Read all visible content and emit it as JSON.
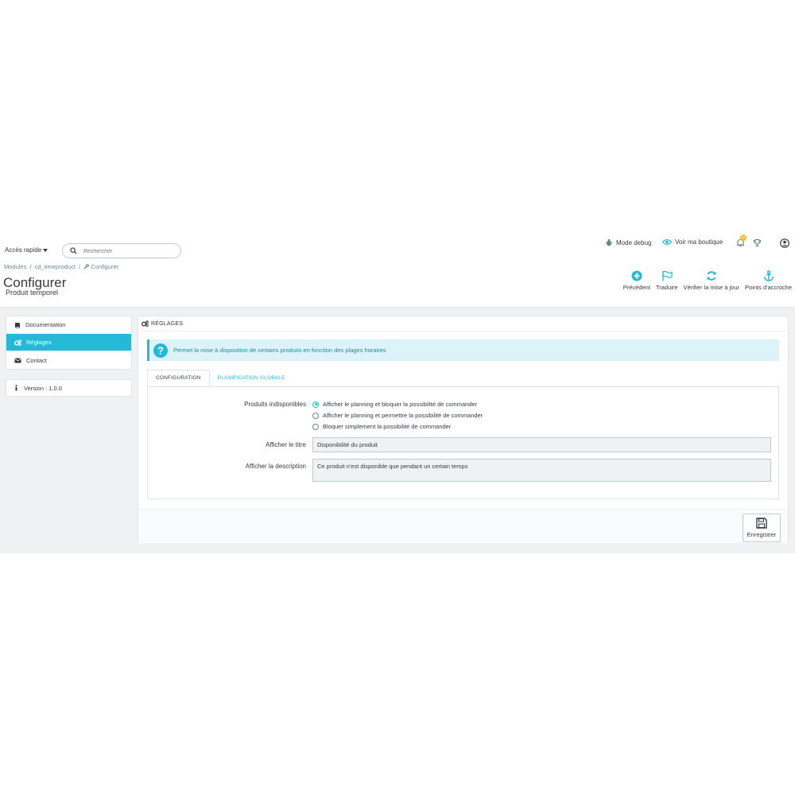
{
  "topbar": {
    "quick_access": "Accès rapide",
    "search_placeholder": "Rechercher",
    "debug_mode": "Mode debug",
    "view_shop": "Voir ma boutique",
    "notifications_count": "11"
  },
  "breadcrumb": {
    "items": [
      "Modules",
      "/",
      "cd_timeproduct",
      "/",
      "Configurer"
    ]
  },
  "header": {
    "title": "Configurer",
    "subtitle": "Produit temporel"
  },
  "toolbar": {
    "back": "Précédent",
    "translate": "Traduire",
    "check_update": "Vérifier la mise à jour",
    "hooks": "Points d'accroche"
  },
  "sidebar": {
    "items": [
      {
        "label": "Documentation"
      },
      {
        "label": "Réglages"
      },
      {
        "label": "Contact"
      }
    ],
    "version": "Version : 1.0.0"
  },
  "panel": {
    "heading": "RÉGLAGES",
    "alert": "Permet la mise à disposition de certains produits en fonction des plages horaires",
    "tabs": [
      {
        "label": "CONFIGURATION"
      },
      {
        "label": "PLANIFICATION GLOBALE"
      }
    ],
    "form": {
      "unavailable_label": "Produits indisponibles",
      "options": [
        {
          "label": "Afficher le planning et bloquer la possibilité de commander"
        },
        {
          "label": "Afficher le planning et permettre la possibilité de commander"
        },
        {
          "label": "Bloquer simplement la possibilité de commander"
        }
      ],
      "title_label": "Afficher le titre",
      "title_value": "Disponibilité du produit",
      "description_label": "Afficher la description",
      "description_value": "Ce produit n'est disponible que pendant un certain temps"
    },
    "save": "Enregistrer"
  },
  "colors": {
    "accent": "#25b9d7",
    "alert_bg": "#dcf4f9",
    "content_bg": "#eff1f2"
  }
}
